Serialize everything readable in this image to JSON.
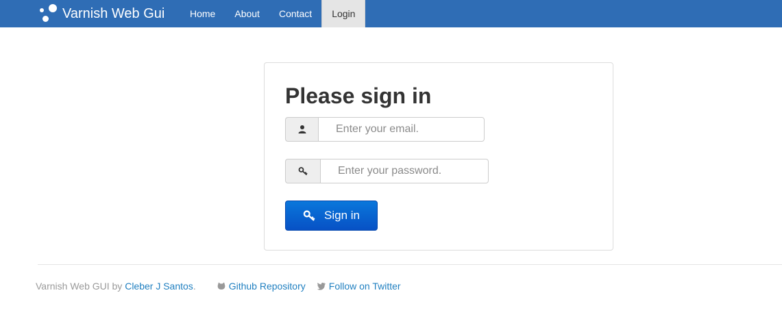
{
  "brand": {
    "title": "Varnish Web Gui"
  },
  "nav": {
    "items": [
      {
        "label": "Home"
      },
      {
        "label": "About"
      },
      {
        "label": "Contact"
      },
      {
        "label": "Login",
        "active": true
      }
    ]
  },
  "login": {
    "title": "Please sign in",
    "email_placeholder": "Enter your email.",
    "email_value": "",
    "email_icon": "user-icon",
    "password_placeholder": "Enter your password.",
    "password_value": "",
    "password_icon": "key-icon",
    "submit_label": "Sign in",
    "submit_icon": "key-icon"
  },
  "footer": {
    "prefix": "Varnish Web GUI by",
    "author": "Cleber J Santos",
    "suffix": ".",
    "github_label": "Github Repository",
    "github_icon": "github-icon",
    "twitter_label": "Follow on Twitter",
    "twitter_icon": "twitter-icon"
  },
  "colors": {
    "navbar": "#2f6db5",
    "button": "#0751c5",
    "link": "#1f7fc0"
  }
}
